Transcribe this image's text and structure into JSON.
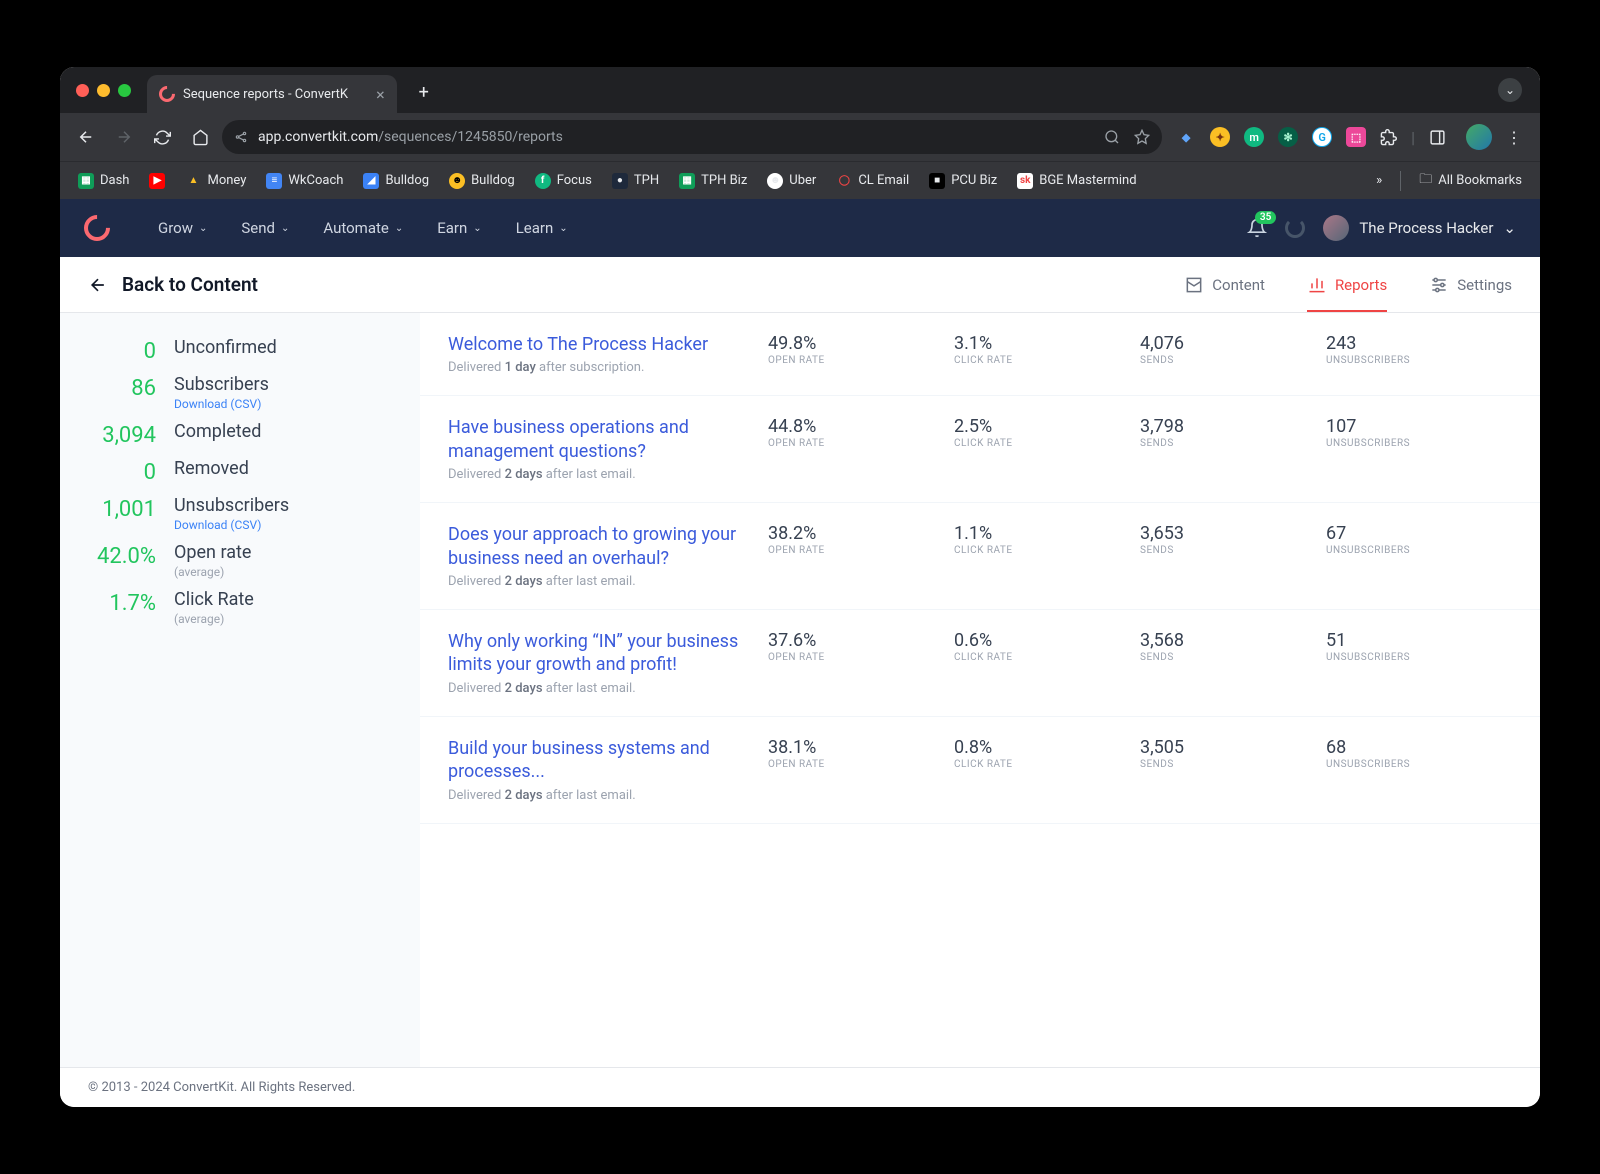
{
  "browser": {
    "tab_title": "Sequence reports - ConvertK",
    "url_host": "app.convertkit.com",
    "url_path": "/sequences/1245850/reports",
    "bookmarks": [
      "Dash",
      "",
      "Money",
      "WkCoach",
      "Bulldog",
      "Bulldog",
      "Focus",
      "TPH",
      "TPH Biz",
      "Uber",
      "CL Email",
      "PCU Biz",
      "BGE Mastermind"
    ],
    "all_bookmarks": "All Bookmarks"
  },
  "nav": {
    "items": [
      "Grow",
      "Send",
      "Automate",
      "Earn",
      "Learn"
    ],
    "notifications": "35",
    "account": "The Process Hacker"
  },
  "subnav": {
    "back": "Back to Content",
    "content": "Content",
    "reports": "Reports",
    "settings": "Settings"
  },
  "sidebar": [
    {
      "value": "0",
      "label": "Unconfirmed"
    },
    {
      "value": "86",
      "label": "Subscribers",
      "sub": "Download (CSV)",
      "sub_link": true
    },
    {
      "value": "3,094",
      "label": "Completed"
    },
    {
      "value": "0",
      "label": "Removed"
    },
    {
      "value": "1,001",
      "label": "Unsubscribers",
      "sub": "Download (CSV)",
      "sub_link": true
    },
    {
      "value": "42.0%",
      "label": "Open rate",
      "sub": "(average)"
    },
    {
      "value": "1.7%",
      "label": "Click Rate",
      "sub": "(average)"
    }
  ],
  "labels": {
    "open_rate": "OPEN RATE",
    "click_rate": "CLICK RATE",
    "sends": "SENDS",
    "unsubscribers": "UNSUBSCRIBERS",
    "delivered": "Delivered ",
    "after_sub": " after subscription.",
    "after_last": " after last email."
  },
  "emails": [
    {
      "title": "Welcome to The Process Hacker",
      "delay": "1 day",
      "after": "sub",
      "open": "49.8%",
      "click": "3.1%",
      "sends": "4,076",
      "unsub": "243"
    },
    {
      "title": "Have business operations and management questions?",
      "delay": "2 days",
      "after": "last",
      "open": "44.8%",
      "click": "2.5%",
      "sends": "3,798",
      "unsub": "107"
    },
    {
      "title": "Does your approach to growing your business need an overhaul?",
      "delay": "2 days",
      "after": "last",
      "open": "38.2%",
      "click": "1.1%",
      "sends": "3,653",
      "unsub": "67"
    },
    {
      "title": "Why only working “IN” your business limits your growth and profit!",
      "delay": "2 days",
      "after": "last",
      "open": "37.6%",
      "click": "0.6%",
      "sends": "3,568",
      "unsub": "51"
    },
    {
      "title": "Build your business systems and processes...",
      "delay": "2 days",
      "after": "last",
      "open": "38.1%",
      "click": "0.8%",
      "sends": "3,505",
      "unsub": "68"
    }
  ],
  "footer": "© 2013 - 2024 ConvertKit. All Rights Reserved."
}
